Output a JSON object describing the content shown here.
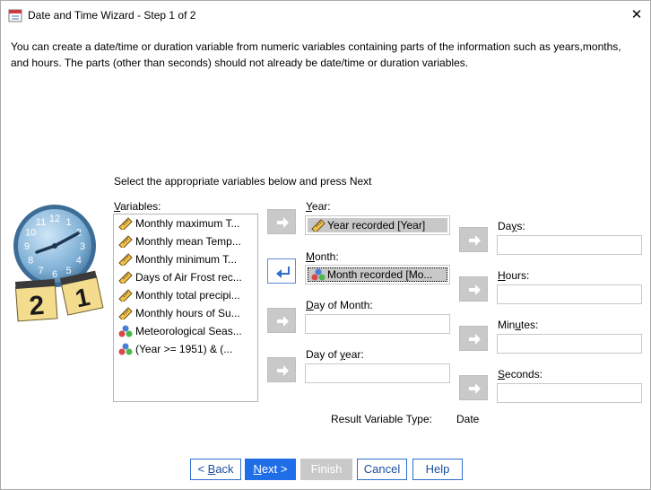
{
  "window": {
    "title": "Date and Time Wizard - Step 1 of 2"
  },
  "description": "You can create a date/time or duration variable from numeric variables containing parts of the information such as years,months, and hours. The parts (other than seconds) should not already be date/time or duration variables.",
  "instruction": "Select the appropriate variables below and press Next",
  "variables": {
    "label_prefix": "",
    "label_u": "V",
    "label_rest": "ariables:",
    "items": [
      {
        "label": "Monthly maximum T...",
        "icon": "ruler-icon"
      },
      {
        "label": "Monthly mean Temp...",
        "icon": "ruler-icon"
      },
      {
        "label": "Monthly minimum T...",
        "icon": "ruler-icon"
      },
      {
        "label": "Days of Air Frost rec...",
        "icon": "ruler-icon"
      },
      {
        "label": "Monthly total precipi...",
        "icon": "ruler-icon"
      },
      {
        "label": "Monthly hours of Su...",
        "icon": "ruler-icon"
      },
      {
        "label": "Meteorological Seas...",
        "icon": "nominal-icon"
      },
      {
        "label": "(Year  >= 1951) & (...",
        "icon": "nominal-icon"
      }
    ]
  },
  "fields": {
    "year": {
      "label_u": "Y",
      "label_rest": "ear:",
      "value": "Year recorded [Year]",
      "icon": "ruler-icon"
    },
    "month": {
      "label_u": "M",
      "label_rest": "onth:",
      "value": "Month recorded [Mo...",
      "icon": "nominal-icon"
    },
    "day_of_month": {
      "label_u": "D",
      "label_rest": "ay of Month:",
      "value": ""
    },
    "day_of_year": {
      "label_prefix": "Day of ",
      "label_u": "y",
      "label_rest": "ear:",
      "value": ""
    },
    "days": {
      "label_prefix": "Da",
      "label_u": "y",
      "label_rest": "s:",
      "value": ""
    },
    "hours": {
      "label_u": "H",
      "label_rest": "ours:",
      "value": ""
    },
    "minutes": {
      "label_prefix": "Min",
      "label_u": "u",
      "label_rest": "tes:",
      "value": ""
    },
    "seconds": {
      "label_u": "S",
      "label_rest": "econds:",
      "value": ""
    }
  },
  "result": {
    "label": "Result Variable Type:",
    "value": "Date"
  },
  "buttons": {
    "back": {
      "prefix": "< ",
      "u": "B",
      "rest": "ack"
    },
    "next": {
      "u": "N",
      "rest": "ext",
      "suffix": " >"
    },
    "finish": "Finish",
    "cancel": "Cancel",
    "help": "Help"
  },
  "clock": {
    "numbers": [
      "12",
      "1",
      "2",
      "3",
      "4",
      "5",
      "6",
      "7",
      "8",
      "9",
      "10",
      "11"
    ],
    "calendar_left": "2",
    "calendar_right": "1"
  },
  "colors": {
    "accent": "#1f6ee8",
    "disabled": "#c9c9c9",
    "chip": "#c8c8c8"
  }
}
